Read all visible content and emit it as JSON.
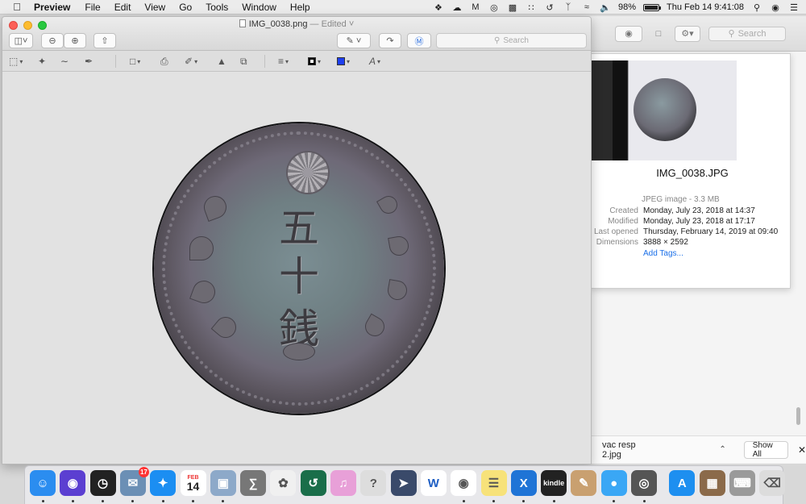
{
  "menubar": {
    "app_name": "Preview",
    "menus": [
      "File",
      "Edit",
      "View",
      "Go",
      "Tools",
      "Window",
      "Help"
    ],
    "battery": "98%",
    "battery_level": 0.98,
    "clock": "Thu Feb 14  9:41:08"
  },
  "preview": {
    "filename": "IMG_0038.png",
    "edited": "— Edited",
    "search_placeholder": "Search",
    "coin_kanji": [
      "五",
      "十",
      "銭"
    ]
  },
  "finder": {
    "search_placeholder": "Search"
  },
  "info": {
    "name": "IMG_0038.JPG",
    "kind": "JPEG image - 3.3 MB",
    "rows": [
      {
        "label": "Created",
        "value": "Monday, July 23, 2018 at 14:37"
      },
      {
        "label": "Modified",
        "value": "Monday, July 23, 2018 at 17:17"
      },
      {
        "label": "Last opened",
        "value": "Thursday, February 14, 2019 at 09:40"
      },
      {
        "label": "Dimensions",
        "value": "3888 × 2592"
      }
    ],
    "add_tags": "Add Tags..."
  },
  "downloads": {
    "file": "vac resp 2.jpg",
    "show_all": "Show All"
  },
  "dock": {
    "mail_badge": "17",
    "calendar_day": "14",
    "calendar_month": "FEB",
    "kindle_label": "kindle",
    "apps": [
      {
        "name": "finder",
        "color": "#2b8df0"
      },
      {
        "name": "siri",
        "color": "#5b3fd1"
      },
      {
        "name": "dashboard",
        "color": "#222222"
      },
      {
        "name": "mail",
        "color": "#6b8fb5"
      },
      {
        "name": "safari",
        "color": "#1b8ef2"
      },
      {
        "name": "calendar",
        "color": "#ffffff"
      },
      {
        "name": "preview",
        "color": "#8da9c9"
      },
      {
        "name": "calculator",
        "color": "#777777"
      },
      {
        "name": "photos",
        "color": "#f0f0f0"
      },
      {
        "name": "time-machine",
        "color": "#1a6e4a"
      },
      {
        "name": "itunes",
        "color": "#e8a0d8"
      },
      {
        "name": "help",
        "color": "#dddddd"
      },
      {
        "name": "launchpad",
        "color": "#3a4a6a"
      },
      {
        "name": "word",
        "color": "#ffffff"
      },
      {
        "name": "chrome",
        "color": "#ffffff"
      },
      {
        "name": "notes",
        "color": "#f7e27a"
      },
      {
        "name": "crossover",
        "color": "#1f74d6"
      },
      {
        "name": "kindle",
        "color": "#222222"
      },
      {
        "name": "paint",
        "color": "#c9a070"
      },
      {
        "name": "messages",
        "color": "#3aa7f5"
      },
      {
        "name": "photo-booth",
        "color": "#555555"
      },
      {
        "name": "app-store",
        "color": "#1d8ff0"
      },
      {
        "name": "photo-thumb",
        "color": "#8b6a4a"
      },
      {
        "name": "keyboard-viewer",
        "color": "#9a9a9a"
      },
      {
        "name": "trash",
        "color": "#dcdcdc"
      }
    ]
  }
}
